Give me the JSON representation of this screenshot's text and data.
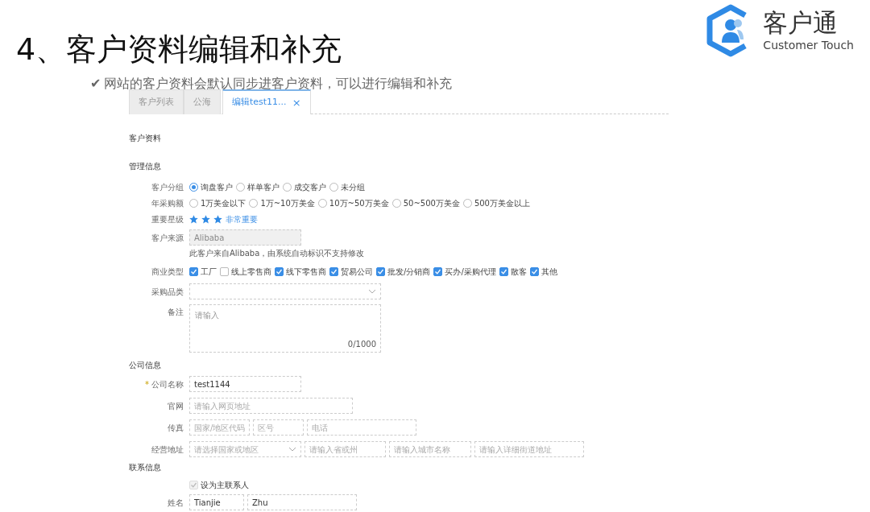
{
  "slide": {
    "title": "4、客户资料编辑和补充",
    "bullet": "✔",
    "subtitle": "网站的客户资料会默认同步进客户资料，可以进行编辑和补充"
  },
  "logo": {
    "name": "客户通",
    "tagline": "Customer Touch"
  },
  "tabs": [
    {
      "label": "客户列表",
      "selected": false
    },
    {
      "label": "公海",
      "selected": false
    },
    {
      "label": "编辑test11...",
      "selected": true,
      "close": "×"
    }
  ],
  "form": {
    "title": "客户资料",
    "sections": [
      {
        "title": "管理信息",
        "fields": [
          {
            "kind": "radio",
            "label": "客户分组",
            "options": [
              {
                "label": "询盘客户",
                "selected": true
              },
              {
                "label": "样单客户",
                "selected": false
              },
              {
                "label": "成交客户",
                "selected": false
              },
              {
                "label": "未分组",
                "selected": false
              }
            ]
          },
          {
            "kind": "radio",
            "label": "年采购额",
            "options": [
              {
                "label": "1万美金以下",
                "selected": false
              },
              {
                "label": "1万~10万美金",
                "selected": false
              },
              {
                "label": "10万~50万美金",
                "selected": false
              },
              {
                "label": "50~500万美金",
                "selected": false
              },
              {
                "label": "500万美金以上",
                "selected": false
              }
            ]
          },
          {
            "kind": "stars",
            "label": "重要星级",
            "stars": 3,
            "note": "非常重要"
          },
          {
            "kind": "readonly",
            "label": "客户来源",
            "value": "Alibaba",
            "hint": "此客户来自Alibaba，由系统自动标识不支持修改"
          },
          {
            "kind": "checkbox",
            "label": "商业类型",
            "options": [
              {
                "label": "工厂",
                "checked": true
              },
              {
                "label": "线上零售商",
                "checked": false
              },
              {
                "label": "线下零售商",
                "checked": true
              },
              {
                "label": "贸易公司",
                "checked": true
              },
              {
                "label": "批发/分销商",
                "checked": true
              },
              {
                "label": "买办/采购代理",
                "checked": true
              },
              {
                "label": "散客",
                "checked": true
              },
              {
                "label": "其他",
                "checked": true
              }
            ]
          },
          {
            "kind": "inputs",
            "label": "采购品类",
            "inputs": [
              {
                "kind": "select"
              }
            ]
          },
          {
            "kind": "textarea",
            "label": "备注",
            "placeholder": "请输入",
            "counter": "0/1000"
          }
        ]
      },
      {
        "title": "公司信息",
        "fields": [
          {
            "kind": "inputs",
            "label": "公司名称",
            "mark": "*",
            "inputs": [
              {
                "kind": "input",
                "value": "test1144"
              }
            ]
          },
          {
            "kind": "inputs",
            "label": "官网",
            "inputs": [
              {
                "kind": "input",
                "placeholder": "请输入网页地址"
              }
            ]
          },
          {
            "kind": "inputs",
            "label": "传真",
            "inputs": [
              {
                "kind": "input",
                "placeholder": "国家/地区代码"
              },
              {
                "kind": "input",
                "placeholder": "区号"
              },
              {
                "kind": "input",
                "placeholder": "电话"
              }
            ]
          },
          {
            "kind": "inputs",
            "label": "经营地址",
            "inputs": [
              {
                "kind": "select",
                "placeholder": "请选择国家或地区"
              },
              {
                "kind": "input",
                "placeholder": "请输入省或州"
              },
              {
                "kind": "input",
                "placeholder": "请输入城市名称"
              },
              {
                "kind": "input",
                "placeholder": "请输入详细街道地址"
              }
            ]
          }
        ]
      },
      {
        "title": "联系信息",
        "fields": [
          {
            "kind": "check",
            "label": "设为主联系人",
            "checked": true,
            "disabled": true
          },
          {
            "kind": "inputs",
            "label": "姓名",
            "inputs": [
              {
                "kind": "input",
                "value": "Tianjie"
              },
              {
                "kind": "input",
                "value": "Zhu"
              }
            ]
          }
        ]
      }
    ]
  }
}
